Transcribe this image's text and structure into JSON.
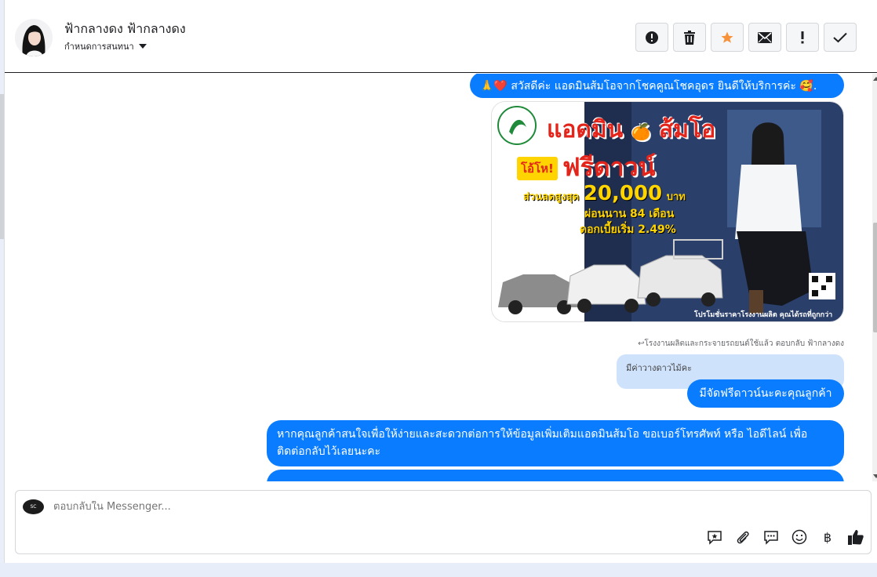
{
  "header": {
    "name": "ฟ้ากลางดง ฟ้ากลางดง",
    "assign_label": "กำหนดการสนทนา"
  },
  "actions": [
    {
      "icon": "alert-circle-icon"
    },
    {
      "icon": "trash-icon"
    },
    {
      "icon": "star-icon",
      "color": "#f7923a"
    },
    {
      "icon": "envelope-icon"
    },
    {
      "icon": "exclamation-icon"
    },
    {
      "icon": "check-icon"
    }
  ],
  "messages": {
    "greeting": "🙏❤️ สวัสดีค่ะ แอดมินส้มโอจากโชคคูณโชคอุดร ยินดีให้บริการค่ะ 🥰.",
    "promo_image": {
      "headline_a": "แอดมิน",
      "headline_b": "ส้มโอ",
      "tag": "โอ้โห!",
      "free_down": "ฟรีดาวน์",
      "discount_label": "ส่วนลดสูงสุด",
      "discount_value": "20,000",
      "discount_unit": "บาท",
      "installment": "ผ่อนนาน 84 เดือน",
      "interest": "ดอกเบี้ยเริ่ม 2.49%",
      "footer": "โปรโมชั่นราคาโรงงานผลิต คุณได้รถที่ถูกกว่า"
    },
    "reply_meta": "↩โรงงานผลิตและกระจายรถยนต์ใช้แล้ว ตอบกลับ ฟ้ากลางดง",
    "quoted_text": "มีค่าวางดาวไม้คะ",
    "answer": "มีจัดฟรีดาวน์นะคะคุณลูกค้า",
    "info_request": "หากคุณลูกค้าสนใจเพื่อให้ง่ายและสะดวกต่อการให้ข้อมูลเพิ่มเติมแอดมินส้มโอ ขอเบอร์โทรศัพท์ หรือ ไอดีไลน์ เพื่อติดต่อกลับไว้เลยนะคะ"
  },
  "composer": {
    "placeholder": "ตอบกลับใน Messenger...",
    "page_badge": "SC",
    "tools": [
      "saved-reply-icon",
      "paperclip-icon",
      "chat-bubble-icon",
      "emoji-icon",
      "baht-icon",
      "thumbs-up-icon"
    ],
    "currency_symbol": "฿"
  },
  "colors": {
    "bubble": "#0a7cff",
    "quoted": "#cfe2fb",
    "promo_red": "#e3241b",
    "promo_yellow": "#ffd400"
  }
}
